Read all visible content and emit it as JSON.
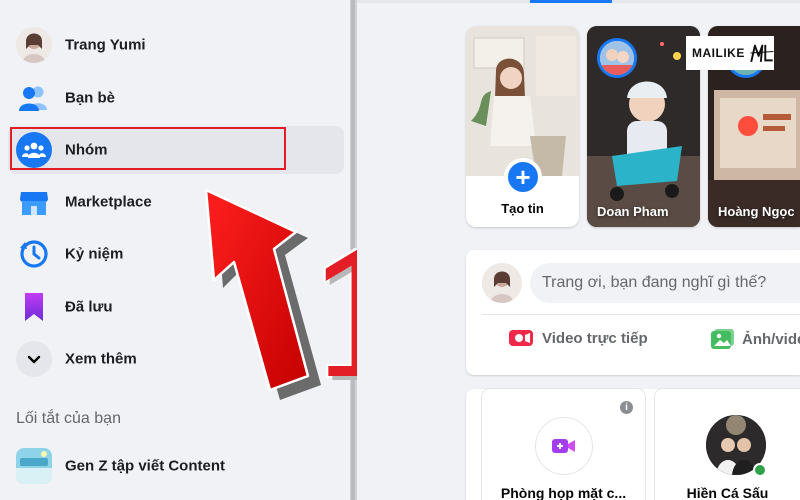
{
  "sidebar": {
    "items": [
      {
        "label": "Trang Yumi",
        "icon": "profile-avatar"
      },
      {
        "label": "Bạn bè",
        "icon": "friends-icon"
      },
      {
        "label": "Nhóm",
        "icon": "groups-icon"
      },
      {
        "label": "Marketplace",
        "icon": "marketplace-icon"
      },
      {
        "label": "Kỷ niệm",
        "icon": "memories-icon"
      },
      {
        "label": "Đã lưu",
        "icon": "saved-icon"
      },
      {
        "label": "Xem thêm",
        "icon": "chevron-down-icon"
      }
    ],
    "shortcuts_title": "Lối tắt của bạn",
    "shortcuts": [
      {
        "label": "Gen Z tập viết Content",
        "icon": "group-thumbnail"
      }
    ]
  },
  "annotation": {
    "number": "1"
  },
  "watermark": {
    "text": "MAILIKE"
  },
  "stories": {
    "create_label": "Tạo tin",
    "items": [
      {
        "name": "Doan Pham"
      },
      {
        "name": "Hoàng Ngọc"
      }
    ]
  },
  "composer": {
    "placeholder": "Trang ơi, bạn đang nghĩ gì thế?",
    "actions": {
      "live": "Video trực tiếp",
      "photo": "Ảnh/vide"
    }
  },
  "rooms": {
    "create_room": "Phòng họp mặt c...",
    "contact": "Hiền Cá Sấu"
  },
  "colors": {
    "brand_blue": "#1877f2",
    "highlight_red": "#e41e27",
    "live_red": "#f02849",
    "photo_green": "#45bd62"
  }
}
